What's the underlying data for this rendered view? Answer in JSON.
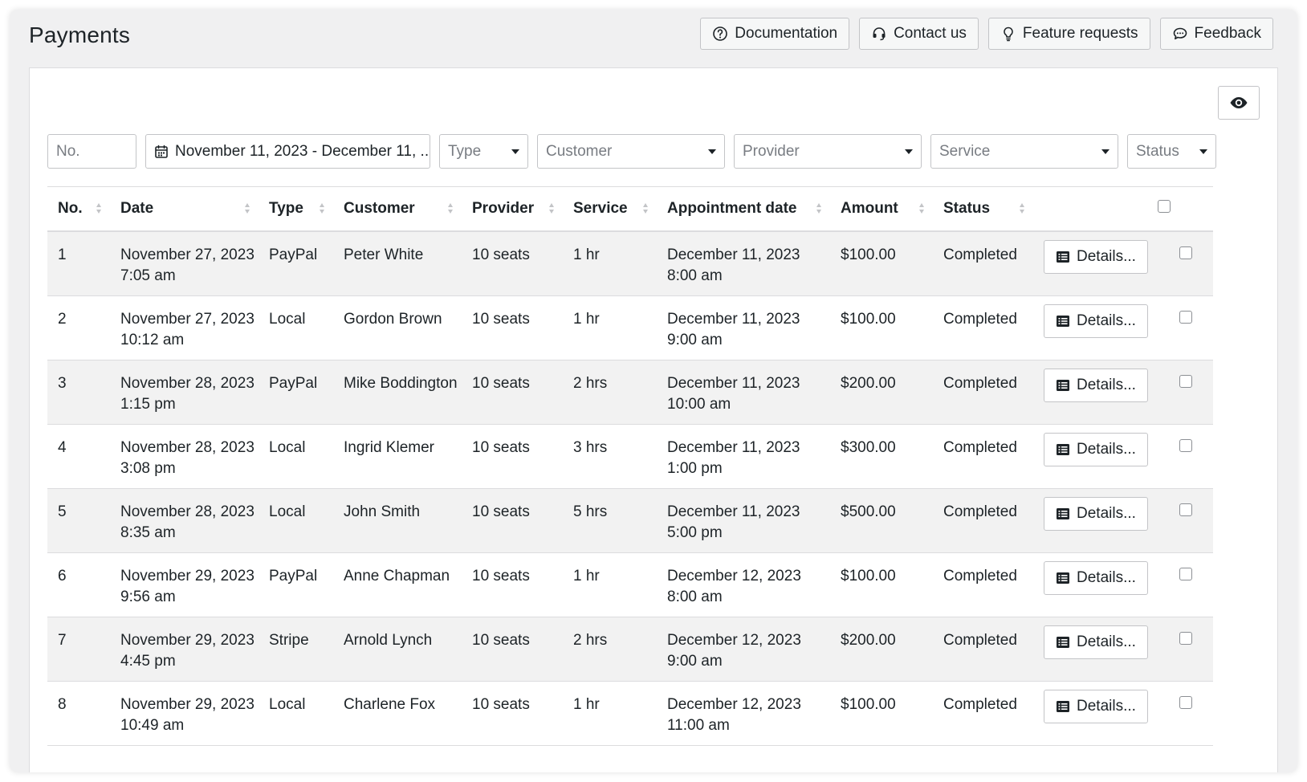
{
  "page": {
    "title": "Payments"
  },
  "top_actions": [
    {
      "label": "Documentation",
      "icon": "question-circle-icon"
    },
    {
      "label": "Contact us",
      "icon": "headset-icon"
    },
    {
      "label": "Feature requests",
      "icon": "lightbulb-icon"
    },
    {
      "label": "Feedback",
      "icon": "chat-bubble-icon"
    }
  ],
  "filters": {
    "number_placeholder": "No.",
    "date_range": "November 11, 2023 - December 11, ...",
    "type_placeholder": "Type",
    "customer_placeholder": "Customer",
    "provider_placeholder": "Provider",
    "service_placeholder": "Service",
    "status_placeholder": "Status"
  },
  "table": {
    "columns": [
      "No.",
      "Date",
      "Type",
      "Customer",
      "Provider",
      "Service",
      "Appointment date",
      "Amount",
      "Status"
    ],
    "details_label": "Details...",
    "rows": [
      {
        "no": "1",
        "date": "November 27, 2023 7:05 am",
        "type": "PayPal",
        "customer": "Peter White",
        "provider": "10 seats",
        "service": "1 hr",
        "appointment": "December 11, 2023 8:00 am",
        "amount": "$100.00",
        "status": "Completed"
      },
      {
        "no": "2",
        "date": "November 27, 2023 10:12 am",
        "type": "Local",
        "customer": "Gordon Brown",
        "provider": "10 seats",
        "service": "1 hr",
        "appointment": "December 11, 2023 9:00 am",
        "amount": "$100.00",
        "status": "Completed"
      },
      {
        "no": "3",
        "date": "November 28, 2023 1:15 pm",
        "type": "PayPal",
        "customer": "Mike Boddington",
        "provider": "10 seats",
        "service": "2 hrs",
        "appointment": "December 11, 2023 10:00 am",
        "amount": "$200.00",
        "status": "Completed"
      },
      {
        "no": "4",
        "date": "November 28, 2023 3:08 pm",
        "type": "Local",
        "customer": "Ingrid Klemer",
        "provider": "10 seats",
        "service": "3 hrs",
        "appointment": "December 11, 2023 1:00 pm",
        "amount": "$300.00",
        "status": "Completed"
      },
      {
        "no": "5",
        "date": "November 28, 2023 8:35 am",
        "type": "Local",
        "customer": "John Smith",
        "provider": "10 seats",
        "service": "5 hrs",
        "appointment": "December 11, 2023 5:00 pm",
        "amount": "$500.00",
        "status": "Completed"
      },
      {
        "no": "6",
        "date": "November 29, 2023 9:56 am",
        "type": "PayPal",
        "customer": "Anne Chapman",
        "provider": "10 seats",
        "service": "1 hr",
        "appointment": "December 12, 2023 8:00 am",
        "amount": "$100.00",
        "status": "Completed"
      },
      {
        "no": "7",
        "date": "November 29, 2023 4:45 pm",
        "type": "Stripe",
        "customer": "Arnold Lynch",
        "provider": "10 seats",
        "service": "2 hrs",
        "appointment": "December 12, 2023 9:00 am",
        "amount": "$200.00",
        "status": "Completed"
      },
      {
        "no": "8",
        "date": "November 29, 2023 10:49 am",
        "type": "Local",
        "customer": "Charlene Fox",
        "provider": "10 seats",
        "service": "1 hr",
        "appointment": "December 12, 2023 11:00 am",
        "amount": "$100.00",
        "status": "Completed"
      }
    ]
  }
}
